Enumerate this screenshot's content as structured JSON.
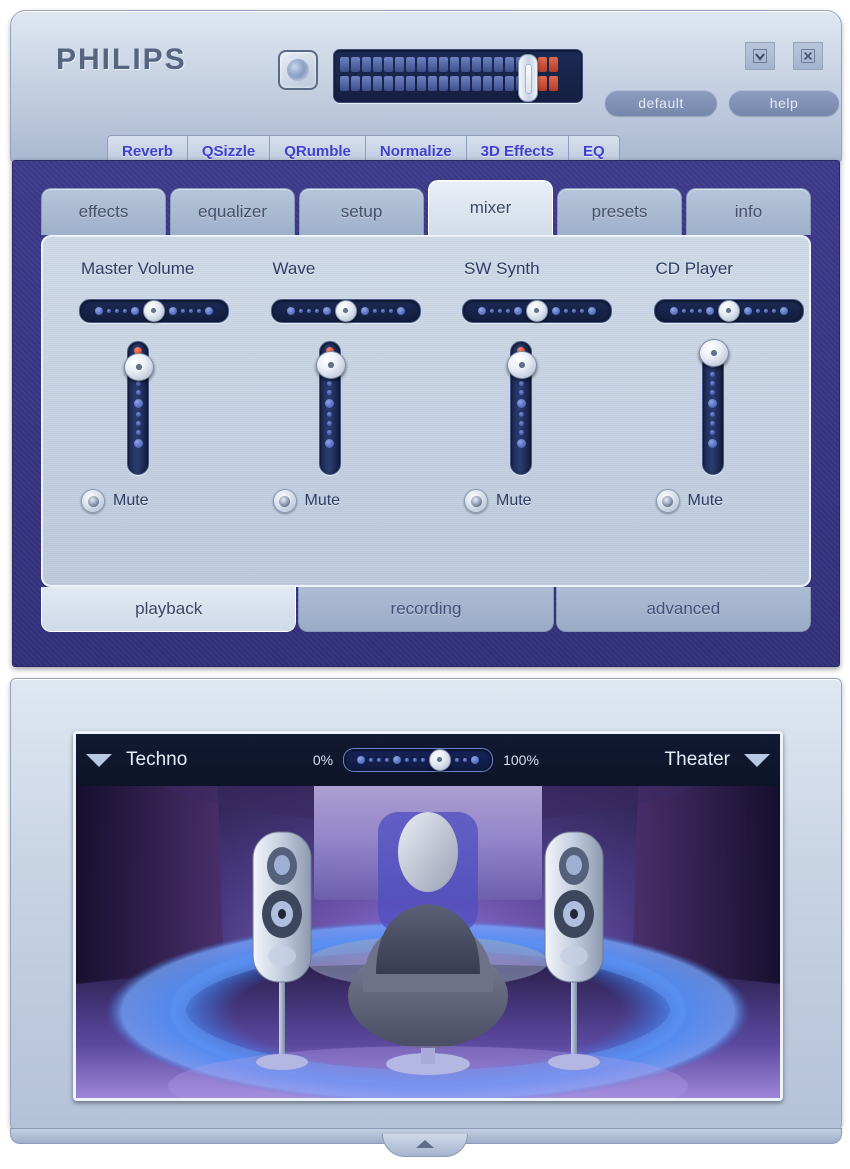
{
  "header": {
    "brand": "PHILIPS",
    "default_label": "default",
    "help_label": "help",
    "minimize_icon": "chevron-down-icon",
    "close_icon": "close-icon",
    "source_icon": "speaker-icon",
    "meter": {
      "blue_segments": 17,
      "red_segments": 3,
      "handle_position_pct": 74
    }
  },
  "effects_tabs": [
    {
      "label": "Reverb"
    },
    {
      "label": "QSizzle"
    },
    {
      "label": "QRumble"
    },
    {
      "label": "Normalize"
    },
    {
      "label": "3D Effects"
    },
    {
      "label": "EQ"
    }
  ],
  "section_tabs": [
    {
      "label": "effects",
      "active": false
    },
    {
      "label": "equalizer",
      "active": false
    },
    {
      "label": "setup",
      "active": false
    },
    {
      "label": "mixer",
      "active": true
    },
    {
      "label": "presets",
      "active": false
    },
    {
      "label": "info",
      "active": false
    }
  ],
  "mixer": {
    "channels": [
      {
        "name": "Master Volume",
        "balance_pct": 50,
        "fader_pct": 84,
        "mute_label": "Mute",
        "muted": false
      },
      {
        "name": "Wave",
        "balance_pct": 50,
        "fader_pct": 86,
        "mute_label": "Mute",
        "muted": false
      },
      {
        "name": "SW Synth",
        "balance_pct": 50,
        "fader_pct": 86,
        "mute_label": "Mute",
        "muted": false
      },
      {
        "name": "CD Player",
        "balance_pct": 50,
        "fader_pct": 97,
        "mute_label": "Mute",
        "muted": false
      }
    ],
    "mode_tabs": [
      {
        "label": "playback",
        "active": true
      },
      {
        "label": "recording",
        "active": false
      },
      {
        "label": "advanced",
        "active": false
      }
    ]
  },
  "visualizer": {
    "left_preset": "Techno",
    "right_preset": "Theater",
    "min_label": "0%",
    "max_label": "100%",
    "blend_pct": 65,
    "scene_description": "Theater room with listener in chair, two floor-standing speakers and blue surround ring"
  },
  "colors": {
    "panel_blue": "#3d3a8c",
    "shell_light": "#cfd9e8",
    "tab_text": "#3f3fd0",
    "label_text": "#2c3b63",
    "slider_track": "#1c2a56",
    "led_blue": "#3650a8",
    "led_red": "#c02a12"
  }
}
